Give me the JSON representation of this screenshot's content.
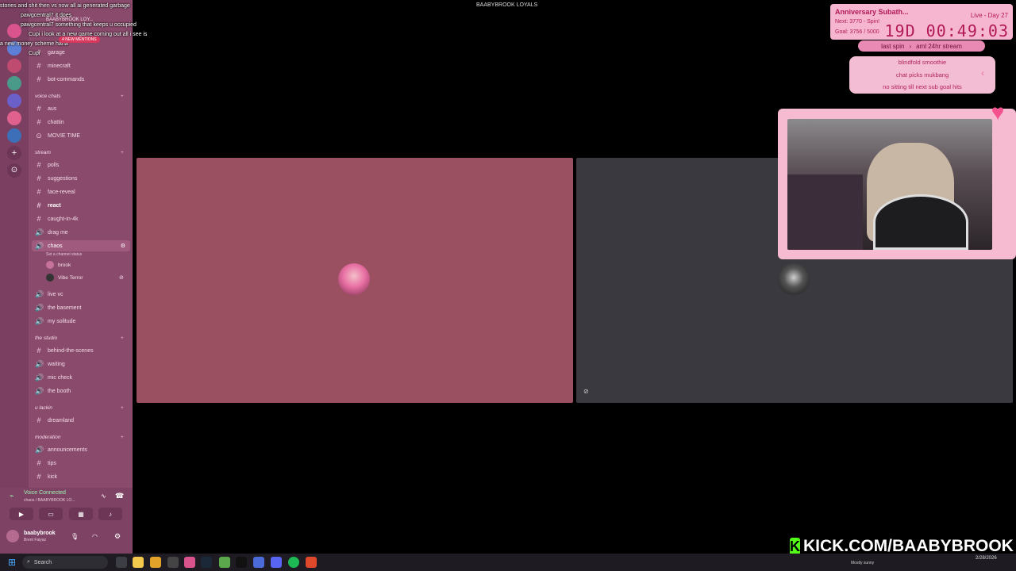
{
  "window": {
    "title": "BAABYBROOK LOYALS"
  },
  "chat_overlay": [
    "stories and shit then vs now all ai generated garbage",
    "pawgcentral7 it does",
    "pawgcentral7 something that keeps u occupied",
    "Cupi i look at a new game coming out all i see is",
    "a new money scheme haha",
    "Cupi"
  ],
  "sidebar": {
    "server_name": "BAABYBROOK LOY...",
    "mentions_badge": "4 NEW MENTIONS",
    "channels_top": [
      {
        "glyph": "#",
        "label": "garage"
      },
      {
        "glyph": "#",
        "label": "minecraft"
      },
      {
        "glyph": "#",
        "label": "bot-commands"
      }
    ],
    "cat_voice": "voice chats",
    "voice_channels": [
      {
        "glyph": "#",
        "label": "aus"
      },
      {
        "glyph": "#",
        "label": "chattin"
      },
      {
        "glyph": "⊙",
        "label": "MOVIE TIME"
      }
    ],
    "cat_stream": "stream",
    "stream_channels": [
      {
        "glyph": "#",
        "label": "polls"
      },
      {
        "glyph": "#",
        "label": "suggestions"
      },
      {
        "glyph": "#",
        "label": "face-reveal"
      },
      {
        "glyph": "#",
        "label": "react"
      },
      {
        "glyph": "#",
        "label": "caught-in-4k"
      },
      {
        "glyph": "🔊",
        "label": "drag me"
      },
      {
        "glyph": "🔊",
        "label": "chaos"
      }
    ],
    "chaos_status": "Set a channel status",
    "members": [
      {
        "name": "brook"
      },
      {
        "name": "Vibe Terror"
      }
    ],
    "more_channels": [
      {
        "glyph": "🔊",
        "label": "live vc"
      },
      {
        "glyph": "🔊",
        "label": "the basement"
      },
      {
        "glyph": "🔊",
        "label": "my solitude"
      }
    ],
    "cat_studio": "the studio",
    "studio_channels": [
      {
        "glyph": "#",
        "label": "behind-the-scenes"
      },
      {
        "glyph": "🔊",
        "label": "waiting"
      },
      {
        "glyph": "🔊",
        "label": "mic check"
      },
      {
        "glyph": "🔊",
        "label": "the booth"
      }
    ],
    "cat_lackin": "u lackin",
    "lackin_channels": [
      {
        "glyph": "#",
        "label": "dreamland"
      }
    ],
    "cat_moderation": "moderation",
    "mod_channels": [
      {
        "glyph": "🔊",
        "label": "announcements"
      },
      {
        "glyph": "#",
        "label": "tips"
      },
      {
        "glyph": "#",
        "label": "kick"
      }
    ]
  },
  "voice_panel": {
    "status": "Voice Connected",
    "sub": "chaos / BAABYBROOK LO...",
    "user_name": "baabybrook",
    "user_status": "Brent Faiyaz"
  },
  "subathon": {
    "title": "Anniversary Subath...",
    "live": "Live - Day 27",
    "next": "Next: 3770 - Spin!",
    "goal": "Goal: 3756 / 5000",
    "timer": "19D 00:49:03"
  },
  "spin_pill": {
    "left": "last spin",
    "right": "aml 24hr stream"
  },
  "wheel_items": [
    "blindfold smoothie",
    "chat picks mukbang",
    "no sitting till next sub goal hits"
  ],
  "kick_url": "KICK.COM/BAABYBROOK",
  "taskbar": {
    "search_placeholder": "Search",
    "weather": "Mostly sunny",
    "date": "2/28/2026"
  }
}
